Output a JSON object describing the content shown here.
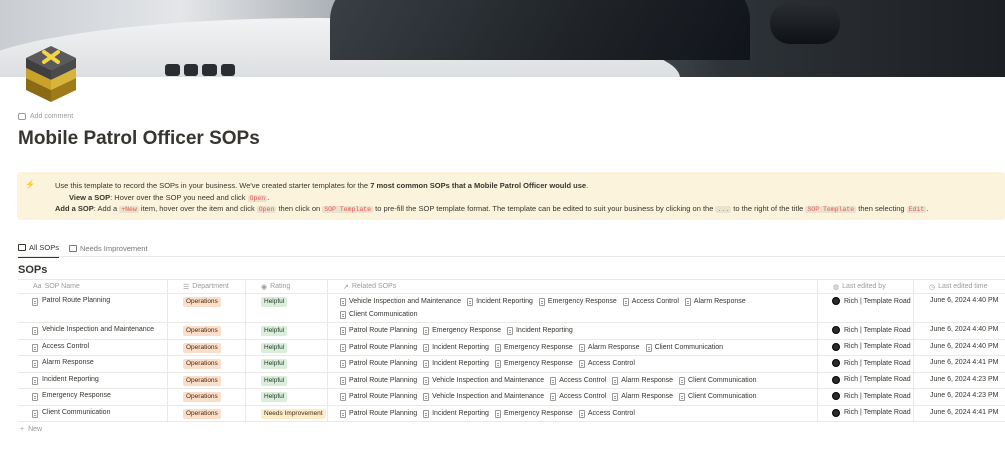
{
  "page": {
    "add_comment": "Add comment",
    "title": "Mobile Patrol Officer SOPs"
  },
  "callout": {
    "icon": "lightning-icon",
    "line1_pre": "Use this template to record the SOPs in your business. We've created starter templates for the ",
    "line1_bold": "7 most common SOPs that a Mobile Patrol Officer would use",
    "line1_post": ".",
    "line2_bold": "View a SOP",
    "line2_pre": ": Hover over the SOP you need and click ",
    "line2_code": "Open",
    "line2_post": ".",
    "line3_bold": "Add a SOP",
    "line3_a": ": Add a ",
    "line3_code_new": "+New",
    "line3_b": " item, hover over the item and click ",
    "line3_code_open": "Open",
    "line3_c": " then click on ",
    "line3_code_tpl": "SOP Template",
    "line3_d": " to pre-fill the SOP template format. The template can be edited to suit your business by clicking on the ",
    "line3_code_dots": "...",
    "line3_e": " to the right of the title ",
    "line3_code_tpl2": "SOP Template",
    "line3_f": " then selecting ",
    "line3_code_edit": "Edit",
    "line3_g": "."
  },
  "views": [
    {
      "label": "All SOPs",
      "icon": "table-icon",
      "active": true
    },
    {
      "label": "Needs Improvement",
      "icon": "table-icon",
      "active": false
    }
  ],
  "database": {
    "title": "SOPs",
    "columns": {
      "name": "SOP Name",
      "department": "Department",
      "rating": "Rating",
      "related": "Related SOPs",
      "edited_by": "Last edited by",
      "edited_time": "Last edited time"
    },
    "rows": [
      {
        "name": "Patrol Route Planning",
        "department": "Operations",
        "rating": "Helpful",
        "related": [
          "Vehicle Inspection and Maintenance",
          "Incident Reporting",
          "Emergency Response",
          "Access Control",
          "Alarm Response",
          "Client Communication"
        ],
        "edited_by": "Rich | Template Road",
        "edited_time": "June 6, 2024 4:40 PM"
      },
      {
        "name": "Vehicle Inspection and Maintenance",
        "department": "Operations",
        "rating": "Helpful",
        "related": [
          "Patrol Route Planning",
          "Emergency Response",
          "Incident Reporting"
        ],
        "edited_by": "Rich | Template Road",
        "edited_time": "June 6, 2024 4:40 PM"
      },
      {
        "name": "Access Control",
        "department": "Operations",
        "rating": "Helpful",
        "related": [
          "Patrol Route Planning",
          "Incident Reporting",
          "Emergency Response",
          "Alarm Response",
          "Client Communication"
        ],
        "edited_by": "Rich | Template Road",
        "edited_time": "June 6, 2024 4:40 PM"
      },
      {
        "name": "Alarm Response",
        "department": "Operations",
        "rating": "Helpful",
        "related": [
          "Patrol Route Planning",
          "Incident Reporting",
          "Emergency Response",
          "Access Control"
        ],
        "edited_by": "Rich | Template Road",
        "edited_time": "June 6, 2024 4:41 PM"
      },
      {
        "name": "Incident Reporting",
        "department": "Operations",
        "rating": "Helpful",
        "related": [
          "Patrol Route Planning",
          "Vehicle Inspection and Maintenance",
          "Access Control",
          "Alarm Response",
          "Client Communication"
        ],
        "edited_by": "Rich | Template Road",
        "edited_time": "June 6, 2024 4:23 PM"
      },
      {
        "name": "Emergency Response",
        "department": "Operations",
        "rating": "Helpful",
        "related": [
          "Patrol Route Planning",
          "Vehicle Inspection and Maintenance",
          "Access Control",
          "Alarm Response",
          "Client Communication"
        ],
        "edited_by": "Rich | Template Road",
        "edited_time": "June 6, 2024 4:23 PM"
      },
      {
        "name": "Client Communication",
        "department": "Operations",
        "rating": "Needs Improvement",
        "related": [
          "Patrol Route Planning",
          "Incident Reporting",
          "Emergency Response",
          "Access Control"
        ],
        "edited_by": "Rich | Template Road",
        "edited_time": "June 6, 2024 4:41 PM"
      }
    ],
    "new_label": "New"
  },
  "colors": {
    "callout_bg": "#fbf3db",
    "tag_operations": "#fadec9",
    "tag_helpful": "#dbeddb",
    "tag_needs_improvement": "#fdecc8",
    "code_text": "#eb5757"
  }
}
